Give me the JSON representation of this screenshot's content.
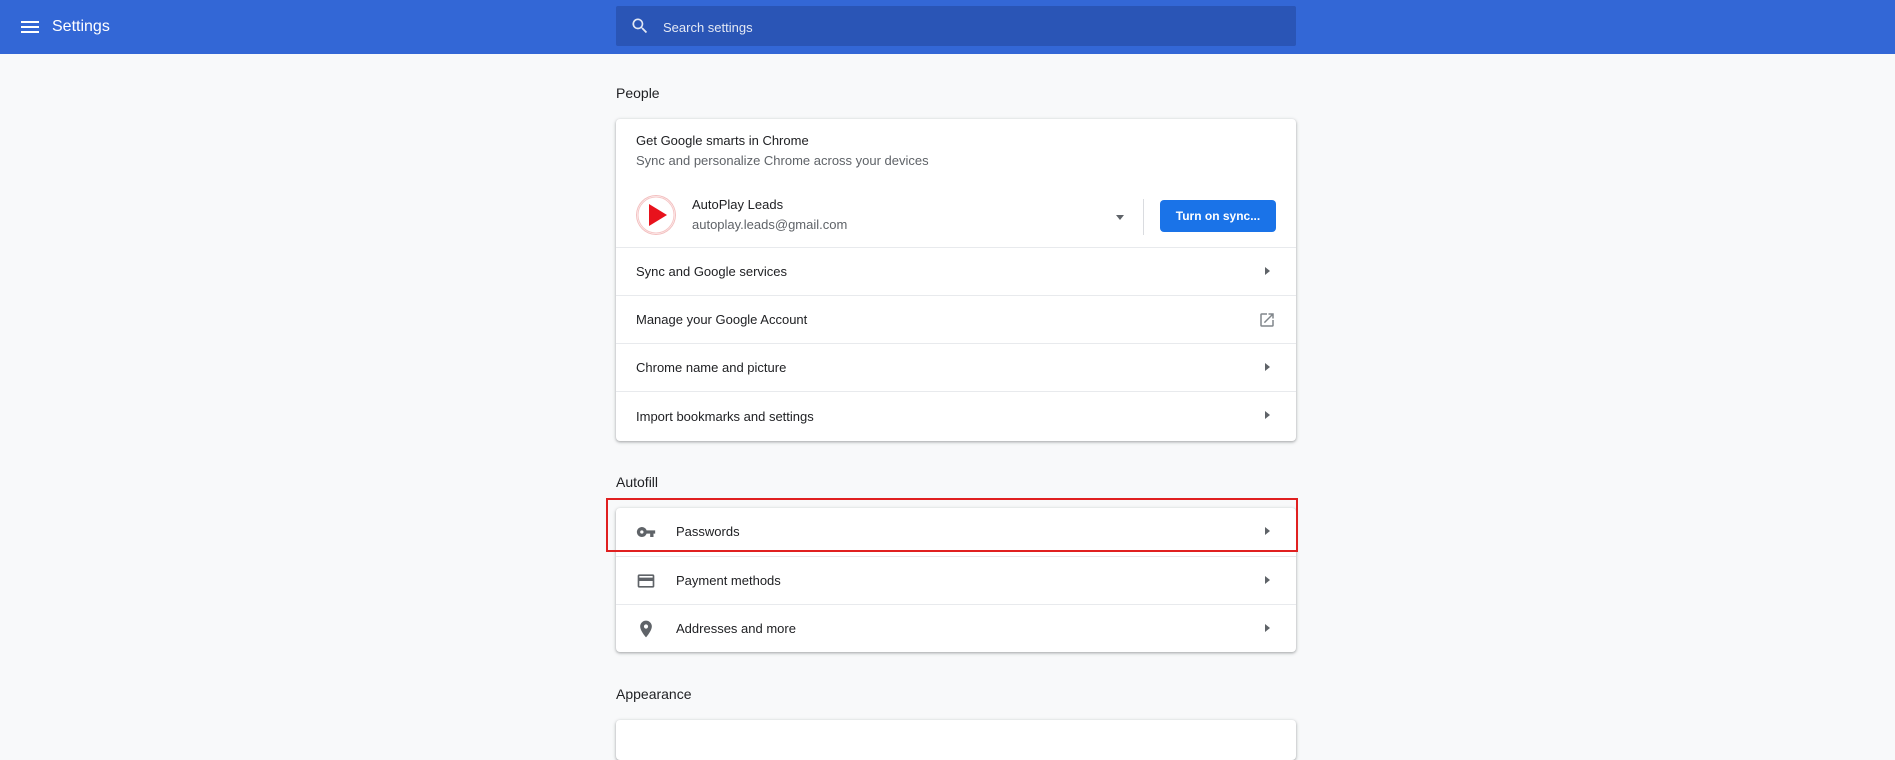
{
  "header": {
    "title": "Settings",
    "search_placeholder": "Search settings",
    "menu_icon": "hamburger-menu-icon",
    "search_icon": "search-icon"
  },
  "people": {
    "section_title": "People",
    "promo_title": "Get Google smarts in Chrome",
    "promo_subtitle": "Sync and personalize Chrome across your devices",
    "account_name": "AutoPlay Leads",
    "account_email": "autoplay.leads@gmail.com",
    "sync_button": "Turn on sync...",
    "items": [
      {
        "label": "Sync and Google services",
        "icon": "chevron-right-icon"
      },
      {
        "label": "Manage your Google Account",
        "icon": "open-in-new-icon"
      },
      {
        "label": "Chrome name and picture",
        "icon": "chevron-right-icon"
      },
      {
        "label": "Import bookmarks and settings",
        "icon": "chevron-right-icon"
      }
    ]
  },
  "autofill": {
    "section_title": "Autofill",
    "items": [
      {
        "label": "Passwords",
        "icon": "key-icon"
      },
      {
        "label": "Payment methods",
        "icon": "credit-card-icon"
      },
      {
        "label": "Addresses and more",
        "icon": "location-pin-icon"
      }
    ]
  },
  "appearance": {
    "section_title": "Appearance"
  },
  "colors": {
    "header": "#3367d6",
    "search_bg": "#2a55b6",
    "primary_button": "#1a73e8",
    "highlight_border": "#e02020",
    "avatar_red": "#e8121c"
  }
}
